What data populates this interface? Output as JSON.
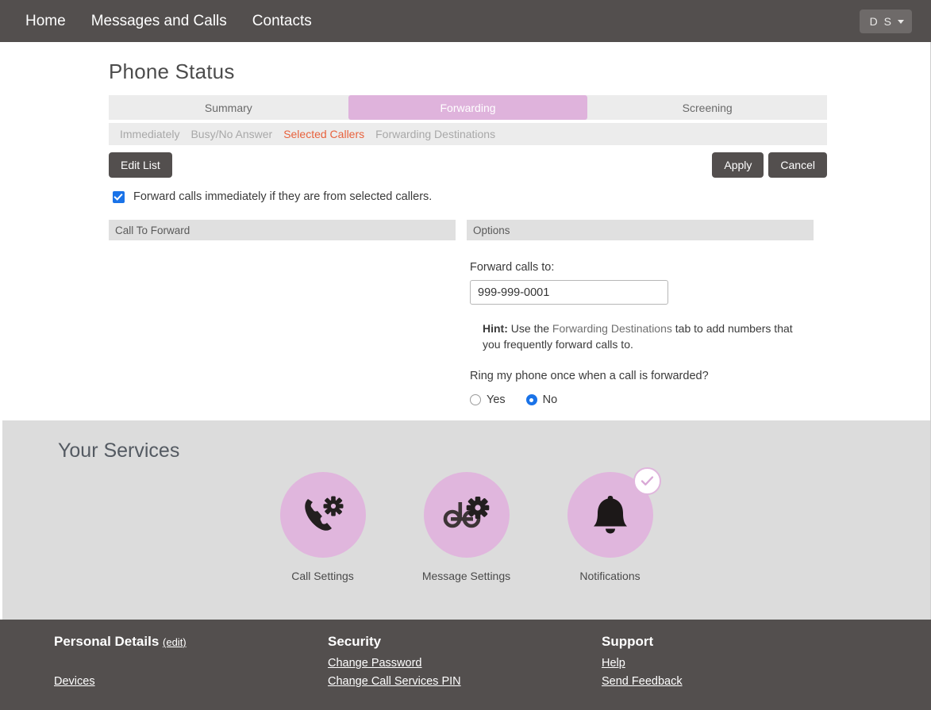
{
  "topnav": {
    "links": [
      {
        "label": "Home"
      },
      {
        "label": "Messages and Calls"
      },
      {
        "label": "Contacts"
      }
    ],
    "user_initials": "D S",
    "caret_icon": "chevron-down-icon"
  },
  "page": {
    "title": "Phone Status"
  },
  "tabs": [
    {
      "label": "Summary",
      "active": false
    },
    {
      "label": "Forwarding",
      "active": true
    },
    {
      "label": "Screening",
      "active": false
    }
  ],
  "subtabs": [
    {
      "label": "Immediately",
      "active": false
    },
    {
      "label": "Busy/No Answer",
      "active": false
    },
    {
      "label": "Selected Callers",
      "active": true
    },
    {
      "label": "Forwarding Destinations",
      "active": false
    }
  ],
  "actions": {
    "edit_list": "Edit List",
    "apply": "Apply",
    "cancel": "Cancel"
  },
  "checkbox": {
    "label": "Forward calls immediately if they are from selected callers.",
    "checked": true
  },
  "panels": {
    "left": {
      "header": "Call To Forward"
    },
    "right": {
      "header": "Options",
      "field_label": "Forward calls to:",
      "field_value": "999-999-0001",
      "field_placeholder": "",
      "hint_prefix": "Hint:",
      "hint_text_1": " Use the ",
      "hint_highlight": "Forwarding Destinations",
      "hint_text_2": " tab to add numbers that you frequently forward calls to.",
      "question": "Ring my phone once when a call is forwarded?",
      "radio_yes": "Yes",
      "radio_no": "No",
      "radio_selected": "No"
    }
  },
  "services": {
    "title": "Your Services",
    "items": [
      {
        "label": "Call Settings",
        "icon": "phone-gear-icon",
        "badge": false
      },
      {
        "label": "Message Settings",
        "icon": "voicemail-gear-icon",
        "badge": false
      },
      {
        "label": "Notifications",
        "icon": "bell-icon",
        "badge": true
      }
    ]
  },
  "footer": {
    "columns": [
      {
        "heading": "Personal Details",
        "edit": "(edit)",
        "links": [
          {
            "label": "Devices"
          }
        ],
        "spacer": true
      },
      {
        "heading": "Security",
        "links": [
          {
            "label": "Change Password"
          },
          {
            "label": "Change Call Services PIN"
          }
        ]
      },
      {
        "heading": "Support",
        "links": [
          {
            "label": "Help"
          },
          {
            "label": "Send Feedback"
          }
        ]
      }
    ]
  },
  "colors": {
    "nav_bg": "#534f4e",
    "accent_pink": "#dfb3dc",
    "active_subtab": "#e8623d",
    "checkbox_blue": "#1a73e8",
    "services_bg": "#dcdcdc"
  }
}
